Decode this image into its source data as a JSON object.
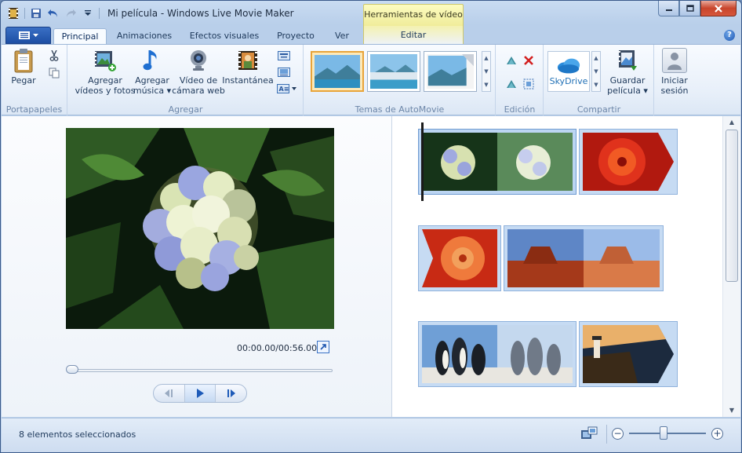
{
  "window": {
    "title": "Mi película - Windows Live Movie Maker",
    "context_tab": "Herramientas de vídeo"
  },
  "tabs": {
    "items": [
      {
        "label": "Principal",
        "active": true
      },
      {
        "label": "Animaciones"
      },
      {
        "label": "Efectos visuales"
      },
      {
        "label": "Proyecto"
      },
      {
        "label": "Ver"
      }
    ],
    "context_label": "Editar"
  },
  "ribbon": {
    "clipboard": {
      "paste": "Pegar",
      "group": "Portapapeles"
    },
    "add": {
      "videos_photos": [
        "Agregar",
        "vídeos y fotos"
      ],
      "music": [
        "Agregar",
        "música ▾"
      ],
      "webcam": [
        "Vídeo de",
        "cámara web"
      ],
      "snapshot": "Instantánea",
      "group": "Agregar"
    },
    "themes": {
      "group": "Temas de AutoMovie"
    },
    "edit": {
      "group": "Edición"
    },
    "share": {
      "skydrive": "SkyDrive",
      "save_movie": [
        "Guardar",
        "película ▾"
      ],
      "group": "Compartir"
    },
    "signin": [
      "Iniciar",
      "sesión"
    ]
  },
  "preview": {
    "timecode": "00:00.00/00:56.00",
    "seek_progress": 0.0
  },
  "status": {
    "text": "8 elementos seleccionados",
    "zoom_level": 0.45
  },
  "colors": {
    "accent": "#1d4fa4",
    "context_tab": "#f0ec9a",
    "clip_selected": "#bcd5f2"
  }
}
